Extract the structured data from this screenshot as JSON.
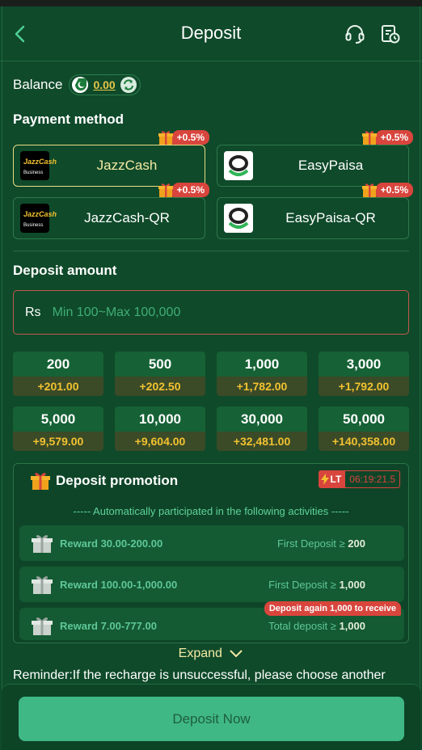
{
  "header": {
    "title": "Deposit"
  },
  "balance": {
    "label": "Balance",
    "value": "0.00"
  },
  "payment_method": {
    "title": "Payment method",
    "options": [
      {
        "name": "JazzCash",
        "bonus": "+0.5%",
        "logo": "jazzcash-logo",
        "logo_text": "JazzCash",
        "logo_sub": "Business",
        "selected": true
      },
      {
        "name": "EasyPaisa",
        "bonus": "+0.5%",
        "logo": "easypaisa-logo",
        "selected": false
      },
      {
        "name": "JazzCash-QR",
        "bonus": "+0.5%",
        "logo": "jazzcash-logo",
        "logo_text": "JazzCash",
        "logo_sub": "Business",
        "selected": false
      },
      {
        "name": "EasyPaisa-QR",
        "bonus": "+0.5%",
        "logo": "easypaisa-logo",
        "selected": false
      }
    ]
  },
  "deposit_amount": {
    "title": "Deposit amount",
    "currency": "Rs",
    "placeholder": "Min 100~Max 100,000",
    "value": ""
  },
  "amount_chips": [
    {
      "amount": "200",
      "bonus": "+201.00"
    },
    {
      "amount": "500",
      "bonus": "+202.50"
    },
    {
      "amount": "1,000",
      "bonus": "+1,782.00"
    },
    {
      "amount": "3,000",
      "bonus": "+1,792.00"
    },
    {
      "amount": "5,000",
      "bonus": "+9,579.00"
    },
    {
      "amount": "10,000",
      "bonus": "+9,604.00"
    },
    {
      "amount": "30,000",
      "bonus": "+32,481.00"
    },
    {
      "amount": "50,000",
      "bonus": "+140,358.00"
    }
  ],
  "promotion": {
    "title": "Deposit promotion",
    "lt_label": "LT",
    "countdown": "06:19:21.5",
    "note": "----- Automatically participated in the following activities -----",
    "rewards": [
      {
        "label": "Reward 30.00-200.00",
        "condition": "First Deposit ≥",
        "condition_value": "200",
        "tag": ""
      },
      {
        "label": "Reward 100.00-1,000.00",
        "condition": "First Deposit ≥",
        "condition_value": "1,000",
        "tag": ""
      },
      {
        "label": "Reward 7.00-777.00",
        "condition": "Total deposit ≥",
        "condition_value": "1,000",
        "tag": "Deposit again 1,000 to receive"
      }
    ],
    "expand_label": "Expand"
  },
  "reminder": "Reminder:If the recharge is unsuccessful, please choose another",
  "deposit_button": "Deposit Now",
  "colors": {
    "background": "#0f4a2a",
    "accent_gold": "#f2c230",
    "accent_red": "#d8453d",
    "button_green": "#3fb886"
  }
}
